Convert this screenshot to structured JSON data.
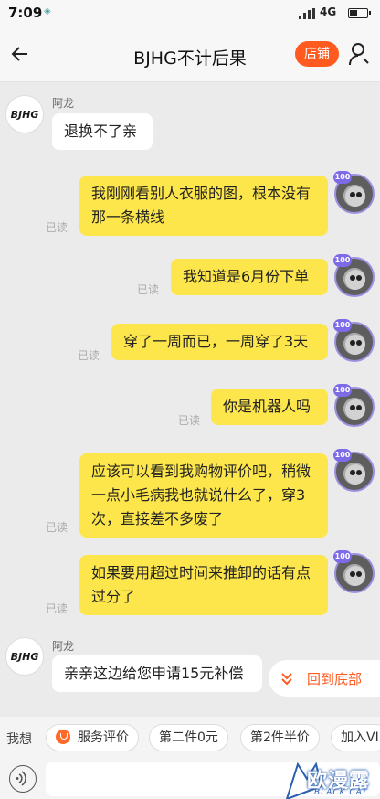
{
  "status_bar": {
    "time": "7:09",
    "location_glyph": "◈",
    "network": "4G"
  },
  "header": {
    "title": "BJHG不计后果",
    "store_label": "店铺"
  },
  "shop": {
    "name": "阿龙",
    "logo_text": "BJHG"
  },
  "user_badge": "100",
  "messages": {
    "m1": "退换不了亲",
    "m2": "我刚刚看别人衣服的图，根本没有那一条横线",
    "m3": "我知道是6月份下单",
    "m4": "穿了一周而已，一周穿了3天",
    "m5": "你是机器人吗",
    "m6": "应该可以看到我购物评价吧，稍微一点小毛病我也就说什么了，穿3次，直接差不多废了",
    "m7": "如果要用超过时间来推卸的话有点过分了",
    "m8": "亲亲这边给您申请15元补偿"
  },
  "read_label": "已读",
  "back_to_bottom_label": "回到底部",
  "quick_bar": {
    "label": "我想",
    "chips": [
      "服务评价",
      "第二件0元",
      "第2件半价",
      "加入VI"
    ]
  },
  "input": {
    "placeholder": ""
  },
  "watermark": {
    "text": "欧漫露",
    "sub": "BLACK CAT"
  },
  "colors": {
    "accent": "#ff5a1f",
    "my_bubble": "#fde64b",
    "badge": "#7c6ae6"
  }
}
